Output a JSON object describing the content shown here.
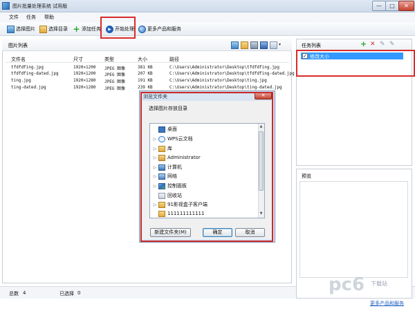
{
  "window": {
    "title": "图片批量处理系统 试用版",
    "min": "—",
    "max": "□",
    "close": "✕"
  },
  "menu": [
    "文件",
    "任务",
    "帮助"
  ],
  "toolbar": {
    "select_images": "选择图片",
    "select_folder": "选择目录",
    "add_task": "添加任务",
    "start_processing": "开始处理",
    "more_products": "更多产品和服务"
  },
  "image_list": {
    "title": "图片列表",
    "columns": [
      "文件名",
      "尺寸",
      "类型",
      "大小",
      "路径"
    ],
    "rows": [
      [
        "tfdfdfing.jpg",
        "1920×1200",
        "JPEG 图像",
        "381 KB",
        "C:\\Users\\Administrator\\Desktop\\tfdfdfing.jpg"
      ],
      [
        "tfdfdfing-dated.jpg",
        "1920×1200",
        "JPEG 图像",
        "207 KB",
        "C:\\Users\\Administrator\\Desktop\\tfdfdfing-dated.jpg"
      ],
      [
        "ting.jpg",
        "1920×1280",
        "JPEG 图像",
        "191 KB",
        "C:\\Users\\Administrator\\Desktop\\ting.jpg"
      ],
      [
        "ting-dated.jpg",
        "1920×1280",
        "JPEG 图像",
        "239 KB",
        "C:\\Users\\Administrator\\Desktop\\ting-dated.jpg"
      ]
    ]
  },
  "status": {
    "total_label": "总数",
    "total_value": "4",
    "selected_label": "已选择",
    "selected_value": "0"
  },
  "task_panel": {
    "title": "任务列表",
    "items": [
      {
        "label": "修改大小",
        "checked": "✓"
      }
    ]
  },
  "preview_panel": {
    "title": "预览"
  },
  "dialog": {
    "title": "浏览文件夹",
    "close": "✕",
    "prompt": "选择图片存放目录",
    "tree": [
      {
        "label": "桌面",
        "arrow": "",
        "icon": "desktop-icon"
      },
      {
        "label": "WPS云文档",
        "arrow": "▷",
        "icon": "cloud-icon"
      },
      {
        "label": "库",
        "arrow": "▷",
        "icon": "library-icon"
      },
      {
        "label": "Administrator",
        "arrow": "▷",
        "icon": "user-icon"
      },
      {
        "label": "计算机",
        "arrow": "▷",
        "icon": "computer-icon"
      },
      {
        "label": "网络",
        "arrow": "▷",
        "icon": "network-icon"
      },
      {
        "label": "控制面板",
        "arrow": "▷",
        "icon": "control-panel-icon"
      },
      {
        "label": "回收站",
        "arrow": "",
        "icon": "recycle-bin-icon"
      },
      {
        "label": "91影视盒子客户端",
        "arrow": "▷",
        "icon": "folder-icon"
      },
      {
        "label": "111111111111",
        "arrow": "",
        "icon": "folder-icon"
      }
    ],
    "new_folder": "新建文件夹(M)",
    "ok": "确定",
    "cancel": "取消"
  },
  "footer": {
    "watermark": "下载站",
    "more_link": "更多产品和服务"
  }
}
